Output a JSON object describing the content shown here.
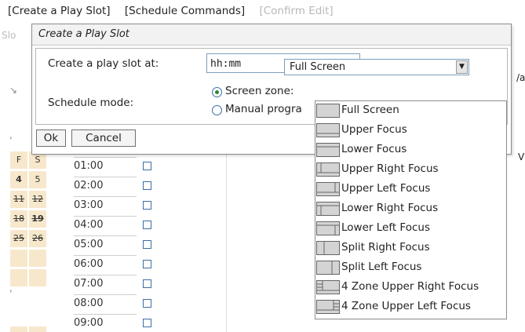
{
  "menu": {
    "create_play_slot": "[Create a Play Slot]",
    "schedule_commands": "[Schedule Commands]",
    "confirm_edit": "[Confirm Edit]"
  },
  "background": {
    "slo_fragment": "Slo",
    "calendar": {
      "days_header": [
        "F",
        "S"
      ],
      "rows": [
        [
          "4",
          "5"
        ],
        [
          "11",
          "12"
        ],
        [
          "18",
          "19"
        ],
        [
          "25",
          "26"
        ]
      ]
    },
    "times": [
      "01:00",
      "02:00",
      "03:00",
      "04:00",
      "05:00",
      "06:00",
      "07:00",
      "08:00",
      "09:00"
    ],
    "right_fragments": [
      "/a",
      "V"
    ]
  },
  "dialog": {
    "title": "Create a Play Slot",
    "create_at_label": "Create a play slot at:",
    "time_value": "hh:mm",
    "schedule_mode_label": "Schedule mode:",
    "screen_zone_label": "Screen zone:",
    "manual_label": "Manual progra",
    "selected_zone": "Full Screen",
    "ok_label": "Ok",
    "cancel_label": "Cancel"
  },
  "zone_options": [
    {
      "label": "Full Screen",
      "icon": "full-screen-layout-icon"
    },
    {
      "label": "Upper Focus",
      "icon": "upper-focus-layout-icon"
    },
    {
      "label": "Lower Focus",
      "icon": "lower-focus-layout-icon"
    },
    {
      "label": "Upper Right Focus",
      "icon": "upper-right-focus-layout-icon"
    },
    {
      "label": "Upper Left Focus",
      "icon": "upper-left-focus-layout-icon"
    },
    {
      "label": "Lower Right Focus",
      "icon": "lower-right-focus-layout-icon"
    },
    {
      "label": "Lower Left Focus",
      "icon": "lower-left-focus-layout-icon"
    },
    {
      "label": "Split Right Focus",
      "icon": "split-right-focus-layout-icon"
    },
    {
      "label": "Split Left Focus",
      "icon": "split-left-focus-layout-icon"
    },
    {
      "label": "4 Zone Upper Right Focus",
      "icon": "four-zone-upper-right-layout-icon"
    },
    {
      "label": "4 Zone Upper Left Focus",
      "icon": "four-zone-upper-left-layout-icon"
    }
  ],
  "colors": {
    "calendar_cell": "#f7e8cc",
    "disabled_text": "#b8b8b8",
    "radio_dot": "#2d8a2d"
  }
}
